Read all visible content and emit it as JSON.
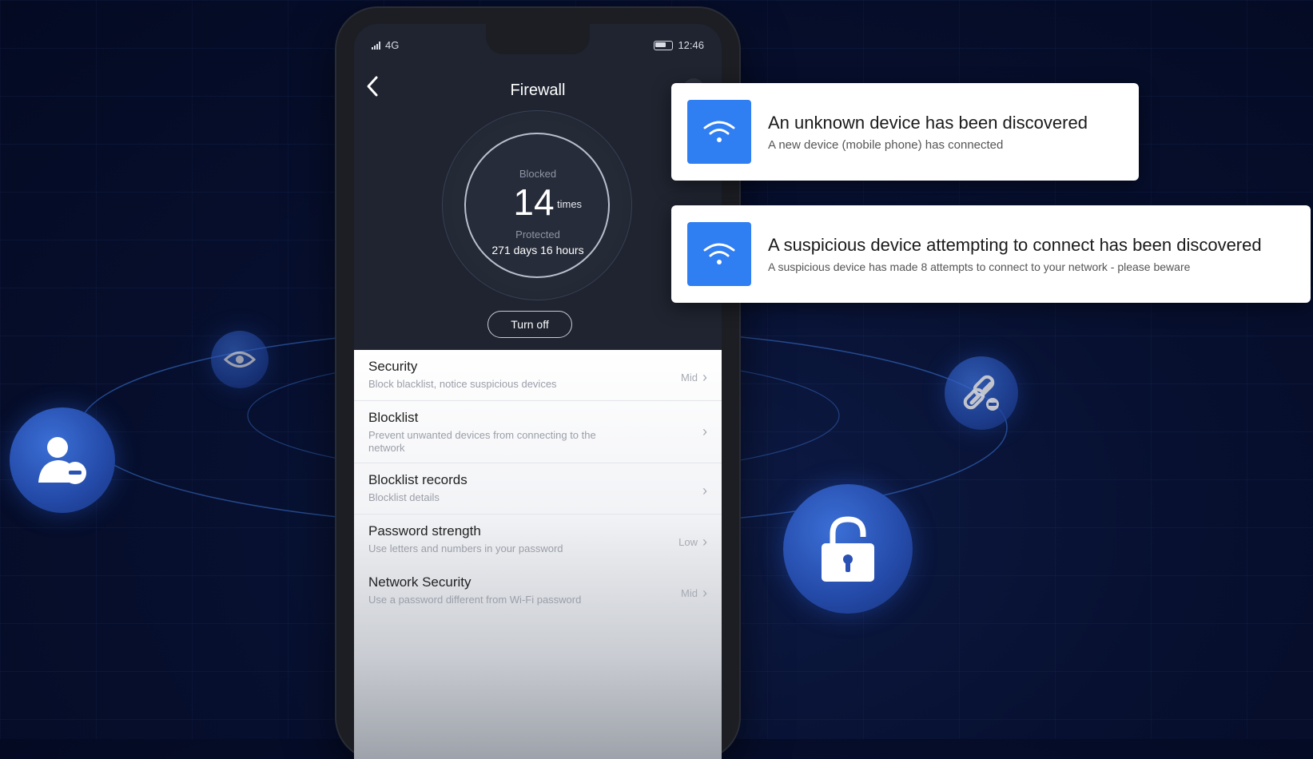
{
  "status_bar": {
    "network": "4G",
    "time": "12:46"
  },
  "header": {
    "title": "Firewall",
    "back_icon": "chevron-left-icon",
    "menu_icon": "menu-icon"
  },
  "dial": {
    "blocked_label": "Blocked",
    "blocked_count": "14",
    "blocked_unit": "times",
    "protected_label": "Protected",
    "protected_duration": "271 days 16 hours"
  },
  "turn_off_label": "Turn off",
  "settings": [
    {
      "title": "Security",
      "description": "Block blacklist, notice suspicious devices",
      "value": "Mid"
    },
    {
      "title": "Blocklist",
      "description": "Prevent unwanted devices from connecting to the network",
      "value": ""
    },
    {
      "title": "Blocklist records",
      "description": "Blocklist details",
      "value": ""
    },
    {
      "title": "Password strength",
      "description": "Use letters and numbers in your password",
      "value": "Low"
    },
    {
      "title": "Network Security",
      "description": "Use a password different from Wi-Fi password",
      "value": "Mid"
    }
  ],
  "notifications": [
    {
      "title": "An unknown device has been discovered",
      "subtitle": "A new device (mobile phone) has connected",
      "icon": "wifi-icon"
    },
    {
      "title": "A suspicious device attempting to connect has been discovered",
      "subtitle": "A suspicious device has made 8 attempts to connect to your network - please beware",
      "icon": "wifi-icon"
    }
  ],
  "badges": [
    "user-remove-icon",
    "eye-icon",
    "lock-icon",
    "unlink-icon"
  ],
  "colors": {
    "accent": "#2f7ef2",
    "background": "#061033",
    "badge": "#2a52b4"
  }
}
